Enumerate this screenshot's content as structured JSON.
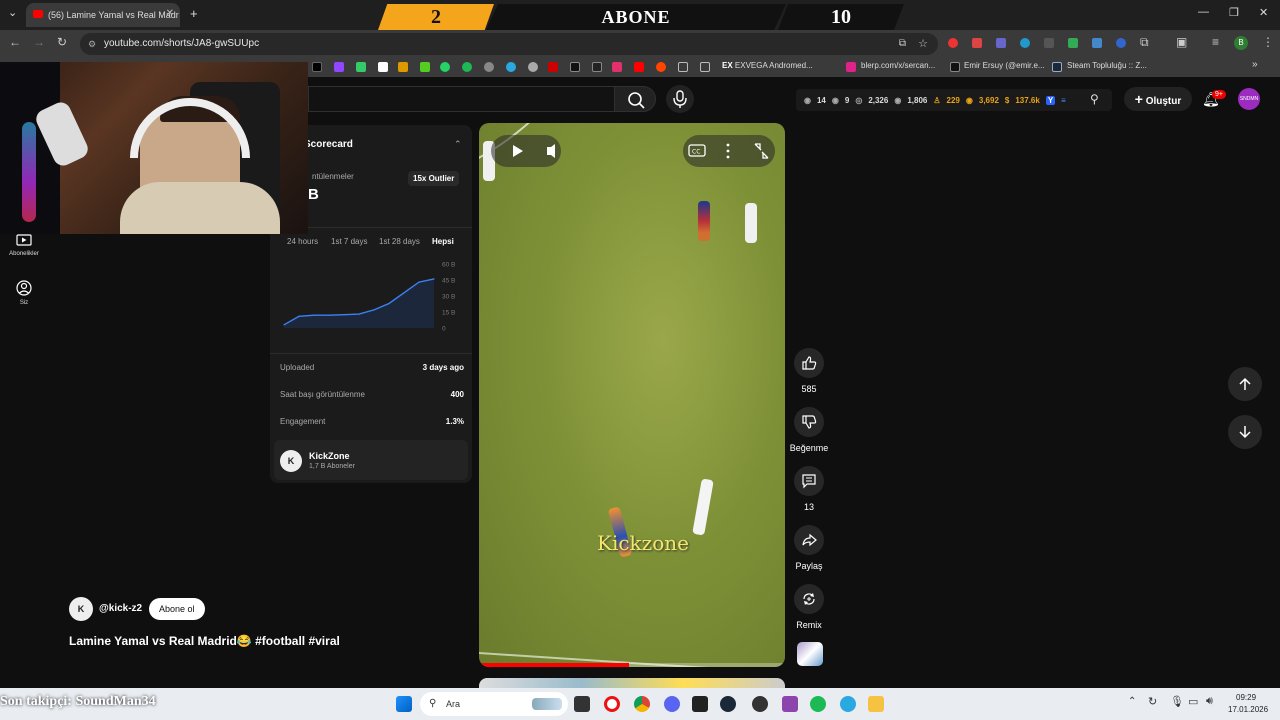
{
  "browser": {
    "tab_title": "(56) Lamine Yamal vs Real Madr",
    "url": "youtube.com/shorts/JA8-gwSUUpc",
    "bookmarks": [
      "EXVEGA Andromed...",
      "blerp.com/x/sercan...",
      "Emir Ersuy (@emir.e...",
      "Steam Topluluğu :: Z..."
    ],
    "profile_initial": "B"
  },
  "banner": {
    "left_value": "2",
    "title": "ABONE",
    "right_value": "10"
  },
  "header_stats": {
    "s1": "14",
    "s2": "9",
    "s3": "2,326",
    "s4": "1,806",
    "s5": "229",
    "s6": "3,692",
    "s7": "137.6k"
  },
  "create_label": "Oluştur",
  "notification_badge": "9+",
  "sidebar": [
    {
      "label": "Abonelikler"
    },
    {
      "label": "Siz"
    }
  ],
  "scorecard": {
    "title": "Scorecard",
    "views_label": "ntülenmeler",
    "views_value": "B",
    "outlier_label": "15x Outlier",
    "tabs": [
      "24 hours",
      "1st 7 days",
      "1st 28 days",
      "Hepsi"
    ],
    "active_tab": "Hepsi",
    "uploaded_label": "Uploaded",
    "uploaded_value": "3 days ago",
    "hourly_label": "Saat başı görüntülenme",
    "hourly_value": "400",
    "engagement_label": "Engagement",
    "engagement_value": "1.3%",
    "channel_name": "KickZone",
    "channel_subs": "1,7 B Aboneler"
  },
  "chart_data": {
    "type": "area",
    "title": "",
    "xlabel": "",
    "ylabel": "",
    "y_ticks": [
      "60 B",
      "45 B",
      "30 B",
      "15 B",
      "0"
    ],
    "ylim": [
      0,
      60
    ],
    "x": [
      0,
      1,
      2,
      3,
      4,
      5,
      6,
      7,
      8,
      9,
      10
    ],
    "values": [
      3,
      11,
      12,
      12,
      12.5,
      13,
      17,
      23,
      33,
      43,
      46
    ],
    "grid": false,
    "legend": "none"
  },
  "video": {
    "watermark": "Kickzone",
    "handle": "@kick-z2",
    "subscribe_label": "Abone ol",
    "caption": "Lamine Yamal vs Real Madrid😂 #football #viral",
    "progress": 0.49
  },
  "actions": {
    "like_count": "585",
    "dislike_label": "Beğenme",
    "comment_count": "13",
    "share_label": "Paylaş",
    "remix_label": "Remix"
  },
  "taskbar": {
    "search_label": "Ara",
    "time": "09:29",
    "date": "17.01.2026"
  },
  "overlay_follower": "Son takipçi: SoundMan34"
}
